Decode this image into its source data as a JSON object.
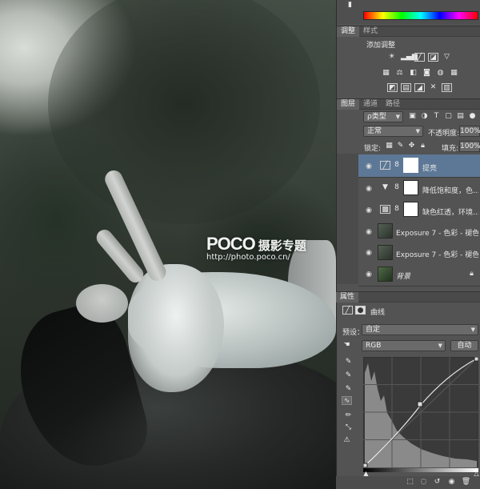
{
  "watermark": {
    "brand": "POCO",
    "title": "摄影专题",
    "url": "http://photo.poco.cn/"
  },
  "color_panel": {
    "spectrum": [
      "#ff0000",
      "#ffff00",
      "#00ff00",
      "#00ffff",
      "#0000ff",
      "#ff00ff",
      "#ff0000"
    ]
  },
  "adjust_panel": {
    "tabs": [
      "调整",
      "样式"
    ],
    "heading": "添加调整"
  },
  "layers_panel": {
    "tabs": [
      "图层",
      "通道",
      "路径"
    ],
    "filter_label": "ρ类型",
    "blend_mode": "正常",
    "opacity_label": "不透明度:",
    "opacity_value": "100%",
    "lock_label": "锁定:",
    "fill_label": "填充:",
    "fill_value": "100%",
    "layers": [
      {
        "name": "提亮",
        "selected": true
      },
      {
        "name": "降低饱和度，色...",
        "selected": false
      },
      {
        "name": "缺色红透，环境...",
        "selected": false
      },
      {
        "name": "Exposure 7 - 色彩 - 褪色...",
        "selected": false
      },
      {
        "name": "Exposure 7 - 色彩 - 褪色...",
        "selected": false
      },
      {
        "name": "背景",
        "selected": false
      }
    ]
  },
  "properties_panel": {
    "tab": "属性",
    "title": "曲线",
    "preset_label": "预设：",
    "preset_value": "自定",
    "channel_value": "RGB",
    "auto_button": "自动"
  }
}
